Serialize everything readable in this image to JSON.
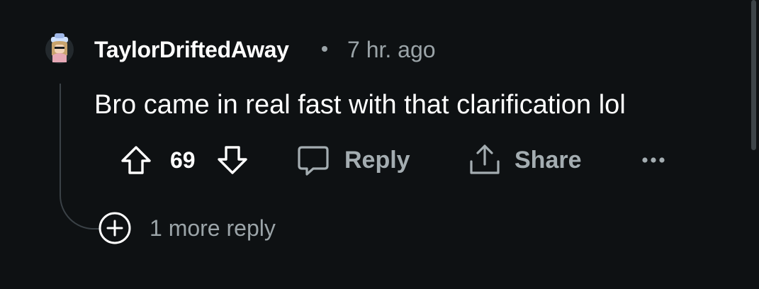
{
  "comment": {
    "author": "TaylorDriftedAway",
    "timestamp": "7 hr. ago",
    "body": "Bro came in real fast with that clarification lol",
    "vote_count": "69",
    "reply_label": "Reply",
    "share_label": "Share",
    "more_replies_label": "1 more reply"
  },
  "icons": {
    "avatar": "avatar-image",
    "upvote": "arrow-up-icon",
    "downvote": "arrow-down-icon",
    "reply": "speech-bubble-icon",
    "share": "share-upload-icon",
    "more": "ellipsis-icon",
    "expand": "plus-circle-icon"
  },
  "colors": {
    "background": "#0e1113",
    "text": "#ffffff",
    "muted": "#9ba4a8",
    "action_text": "#a4adb1",
    "thread_line": "#3a4146"
  }
}
